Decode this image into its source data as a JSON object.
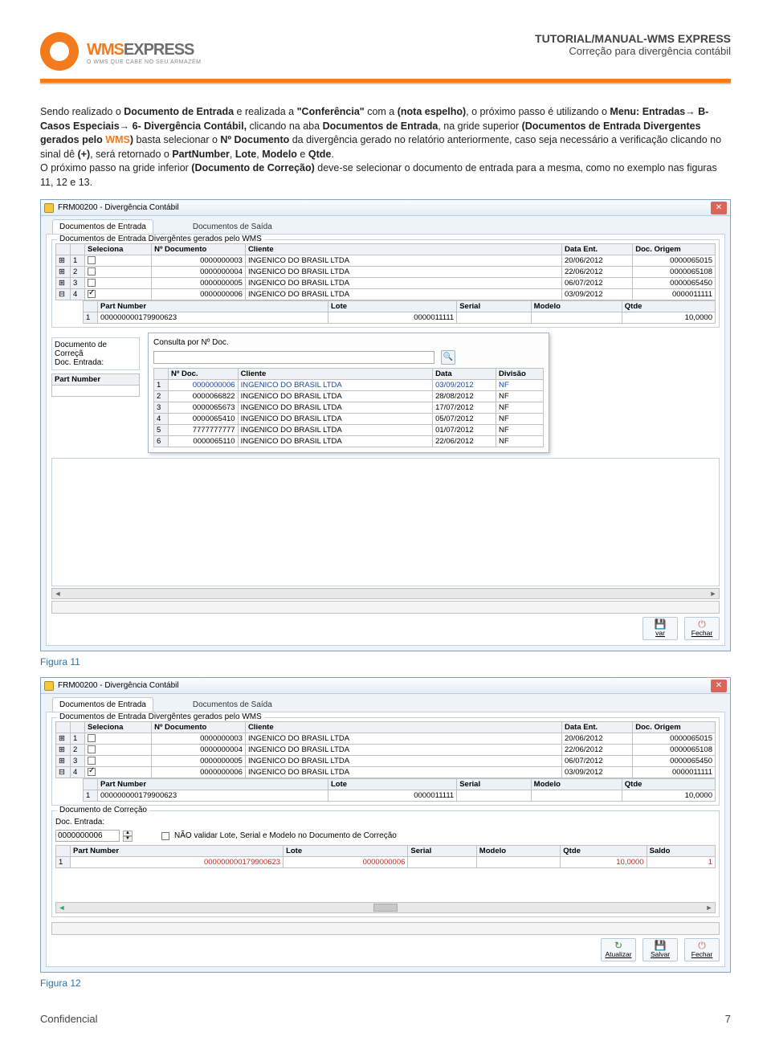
{
  "header": {
    "logo_main": "WMSEXPRESS",
    "logo_tag": "O WMS QUE CABE NO SEU ARMAZÉM",
    "title": "TUTORIAL/MANUAL-WMS EXPRESS",
    "subtitle": "Correção para divergência contábil"
  },
  "paragraph": {
    "pre": "Sendo realizado o ",
    "b1": "Documento de Entrada",
    "mid1": " e realizada a ",
    "b2": "\"Conferência\"",
    "mid2": " com a ",
    "b3": "(nota espelho)",
    "mid3": ", o próximo passo é utilizando o ",
    "b4": "Menu: Entradas→ B- Casos Especiais→ 6- Divergência Contábil,",
    "mid4": " clicando na aba ",
    "b5": "Documentos de Entrada",
    "mid5": ", na gride superior ",
    "b6": "(Documentos de Entrada Divergentes gerados pelo ",
    "wms": "WMS",
    "b6b": ")",
    "mid6": " basta selecionar o ",
    "b7": "Nº Documento",
    "mid7": " da divergência gerado no relatório anteriormente, caso seja necessário a verificação clicando no sinal dê ",
    "b8": "(+)",
    "mid8": ", será retornado o ",
    "b9": "PartNumber",
    "mid9": ", ",
    "b10": "Lote",
    "mid10": ", ",
    "b11": "Modelo",
    "mid11": " e ",
    "b12": "Qtde",
    "period": ".",
    "line2a": "O próximo passo na gride inferior ",
    "b13": "(Documento de Correção)",
    "line2b": " deve-se selecionar o documento de entrada para a mesma, como no exemplo nas figuras 11, 12 e 13."
  },
  "win": {
    "title": "FRM00200 - Divergência Contábil",
    "tab_entrada": "Documentos de Entrada",
    "tab_saida": "Documentos de Saída",
    "group_top": "Documentos de Entrada Divergêntes gerados pelo WMS",
    "cols_top": [
      "",
      "",
      "Seleciona",
      "Nº Documento",
      "Cliente",
      "Data Ent.",
      "Doc. Origem"
    ],
    "rows_top": [
      {
        "exp": "⊞",
        "n": "1",
        "sel": false,
        "doc": "0000000003",
        "cli": "INGENICO DO BRASIL LTDA",
        "data": "20/06/2012",
        "orig": "0000065015"
      },
      {
        "exp": "⊞",
        "n": "2",
        "sel": false,
        "doc": "0000000004",
        "cli": "INGENICO DO BRASIL LTDA",
        "data": "22/06/2012",
        "orig": "0000065108"
      },
      {
        "exp": "⊞",
        "n": "3",
        "sel": false,
        "doc": "0000000005",
        "cli": "INGENICO DO BRASIL LTDA",
        "data": "06/07/2012",
        "orig": "0000065450"
      },
      {
        "exp": "⊟",
        "n": "4",
        "sel": true,
        "doc": "0000000006",
        "cli": "INGENICO DO BRASIL LTDA",
        "data": "03/09/2012",
        "orig": "0000011111"
      }
    ],
    "sub_cols": [
      "",
      "Part Number",
      "Lote",
      "Serial",
      "Modelo",
      "Qtde"
    ],
    "sub_row": {
      "n": "1",
      "pn": "000000000179900623",
      "lote": "0000011111",
      "serial": "",
      "modelo": "",
      "qtde": "10,0000"
    },
    "popup_label": "Consulta por Nº Doc.",
    "side_title": "Documento de Correçã",
    "side_sub": "Doc. Entrada:",
    "side_pn": "Part Number",
    "popup_cols": [
      "",
      "Nº Doc.",
      "Cliente",
      "Data",
      "Divisão"
    ],
    "popup_rows": [
      {
        "n": "1",
        "doc": "0000000006",
        "cli": "INGENICO DO BRASIL LTDA",
        "data": "03/09/2012",
        "div": "NF"
      },
      {
        "n": "2",
        "doc": "0000066822",
        "cli": "INGENICO DO BRASIL LTDA",
        "data": "28/08/2012",
        "div": "NF"
      },
      {
        "n": "3",
        "doc": "0000065673",
        "cli": "INGENICO DO BRASIL LTDA",
        "data": "17/07/2012",
        "div": "NF"
      },
      {
        "n": "4",
        "doc": "0000065410",
        "cli": "INGENICO DO BRASIL LTDA",
        "data": "05/07/2012",
        "div": "NF"
      },
      {
        "n": "5",
        "doc": "7777777777",
        "cli": "INGENICO DO BRASIL LTDA",
        "data": "01/07/2012",
        "div": "NF"
      },
      {
        "n": "6",
        "doc": "0000065110",
        "cli": "INGENICO DO BRASIL LTDA",
        "data": "22/06/2012",
        "div": "NF"
      }
    ],
    "btn_salvar_lb": "var",
    "btn_fechar": "Fechar",
    "btn_atualizar": "Atualizar",
    "btn_salvar_full": "Salvar"
  },
  "win2": {
    "corr_title": "Documento de Correção",
    "doc_label": "Doc. Entrada:",
    "doc_value": "0000000006",
    "chk_label": "NÃO validar Lote, Serial e Modelo no Documento de Correção",
    "cols": [
      "",
      "Part Number",
      "Lote",
      "Serial",
      "Modelo",
      "Qtde",
      "Saldo"
    ],
    "row": {
      "n": "1",
      "pn": "000000000179900623",
      "lote": "0000000006",
      "serial": "",
      "modelo": "",
      "qtde": "10,0000",
      "saldo": "1"
    }
  },
  "fig11": "Figura 11",
  "fig12": "Figura 12",
  "footer_left": "Confidencial",
  "footer_right": "7"
}
